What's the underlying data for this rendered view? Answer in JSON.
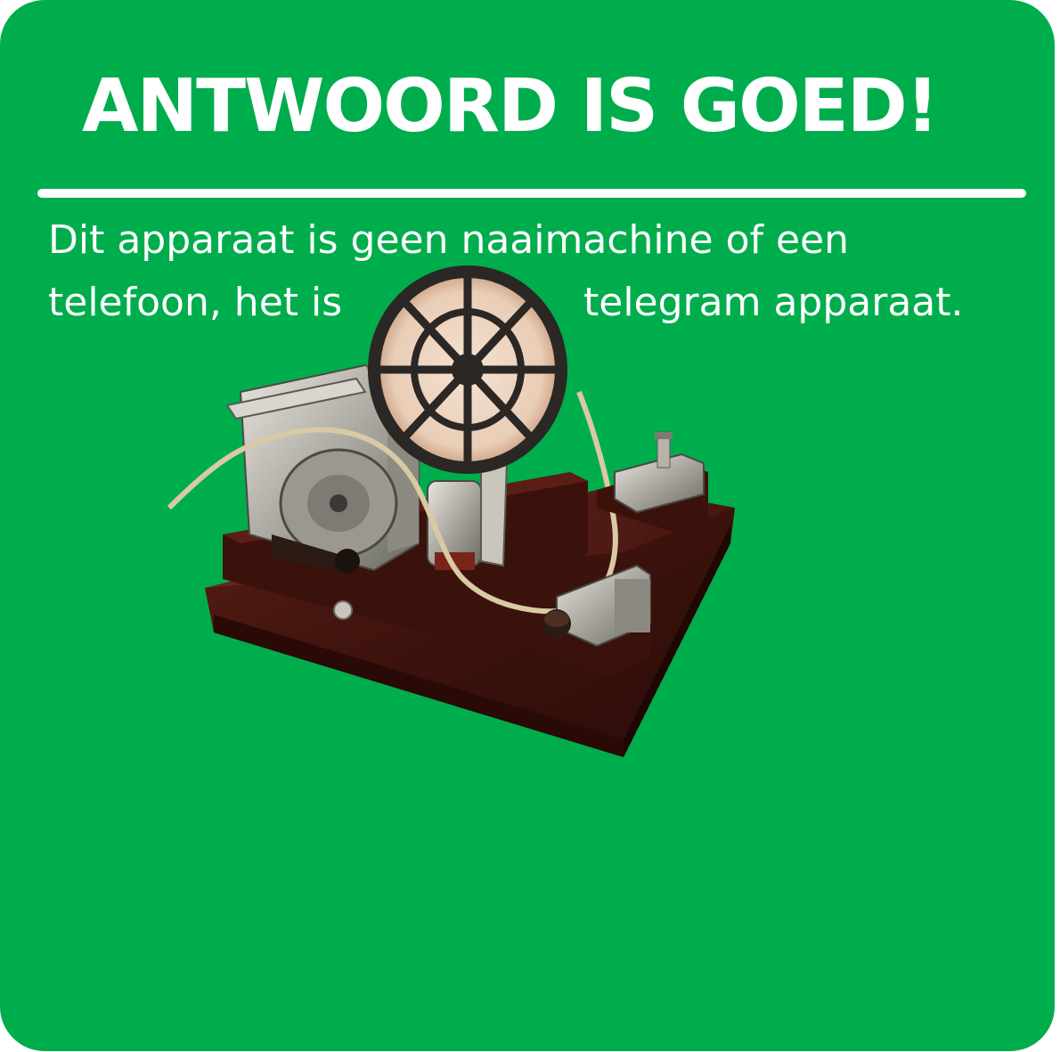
{
  "title": "ANTWOORD IS GOED!",
  "body": {
    "line1": "Dit apparaat is geen naaimachine of een",
    "line2_start": "telefoon, het is",
    "line2_end": "telegram apparaat."
  },
  "colors": {
    "background": "#00ad4d",
    "text": "#ffffff"
  },
  "image": {
    "subject": "telegraph-machine-illustration"
  }
}
